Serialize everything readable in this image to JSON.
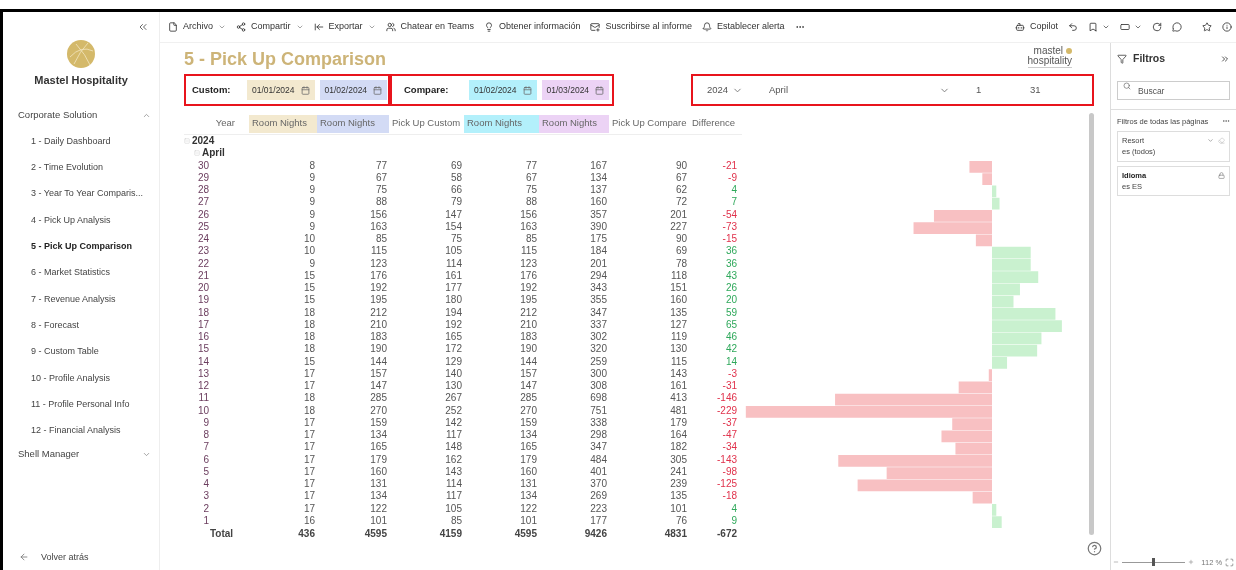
{
  "toolbar": {
    "items": [
      {
        "label": "Archivo",
        "dropdown": true
      },
      {
        "label": "Compartir",
        "dropdown": true
      },
      {
        "label": "Exportar",
        "dropdown": true
      },
      {
        "label": "Chatear en Teams",
        "dropdown": false
      },
      {
        "label": "Obtener información",
        "dropdown": false
      },
      {
        "label": "Suscribirse al informe",
        "dropdown": false
      },
      {
        "label": "Establecer alerta",
        "dropdown": false
      }
    ],
    "copilot": "Copilot"
  },
  "sidebar": {
    "brand": "Mastel Hospitality",
    "sections": [
      {
        "label": "Corporate Solution",
        "expanded": true,
        "children": [
          {
            "label": "1 - Daily Dashboard",
            "selected": false
          },
          {
            "label": "2 - Time Evolution",
            "selected": false
          },
          {
            "label": "3 - Year To Year Comparis...",
            "selected": false
          },
          {
            "label": "4 - Pick Up Analysis",
            "selected": false
          },
          {
            "label": "5 - Pick Up Comparison",
            "selected": true
          },
          {
            "label": "6 - Market Statistics",
            "selected": false
          },
          {
            "label": "7 - Revenue Analysis",
            "selected": false
          },
          {
            "label": "8 - Forecast",
            "selected": false
          },
          {
            "label": "9 - Custom Table",
            "selected": false
          },
          {
            "label": "10 - Profile Analysis",
            "selected": false
          },
          {
            "label": "11 - Profile Personal Info",
            "selected": false
          },
          {
            "label": "12 - Financial Analysis",
            "selected": false
          }
        ]
      },
      {
        "label": "Shell Manager",
        "expanded": false
      }
    ],
    "back": "Volver atrás"
  },
  "report": {
    "title": "5 - Pick Up Comparison",
    "logo": {
      "line1": "mastel",
      "line2": "hospitality"
    },
    "custom": {
      "label": "Custom:",
      "from": {
        "value": "01/01/2024",
        "color": "#f3e9cf"
      },
      "to": {
        "value": "01/02/2024",
        "color": "#d3dbf5"
      }
    },
    "compare": {
      "label": "Compare:",
      "from": {
        "value": "01/02/2024",
        "color": "#b3f0fb"
      },
      "to": {
        "value": "01/03/2024",
        "color": "#ecd3f5"
      }
    },
    "slicer": {
      "year": "2024",
      "month": "April",
      "day_from": "1",
      "day_to": "31"
    },
    "table": {
      "columns": [
        {
          "label": "Year"
        },
        {
          "label": "Room Nights",
          "color": "#f3e9cf"
        },
        {
          "label": "Room Nights",
          "color": "#d3dbf5"
        },
        {
          "label": "Pick Up Custom"
        },
        {
          "label": "Room Nights",
          "color": "#b3f0fb"
        },
        {
          "label": "Room Nights",
          "color": "#ecd3f5"
        },
        {
          "label": "Pick Up Compare"
        },
        {
          "label": "Difference"
        }
      ],
      "groups": [
        "2024",
        "April"
      ],
      "rows": [
        [
          "30",
          "8",
          "77",
          "69",
          "77",
          "167",
          "90",
          "-21"
        ],
        [
          "29",
          "9",
          "67",
          "58",
          "67",
          "134",
          "67",
          "-9"
        ],
        [
          "28",
          "9",
          "75",
          "66",
          "75",
          "137",
          "62",
          "4"
        ],
        [
          "27",
          "9",
          "88",
          "79",
          "88",
          "160",
          "72",
          "7"
        ],
        [
          "26",
          "9",
          "156",
          "147",
          "156",
          "357",
          "201",
          "-54"
        ],
        [
          "25",
          "9",
          "163",
          "154",
          "163",
          "390",
          "227",
          "-73"
        ],
        [
          "24",
          "10",
          "85",
          "75",
          "85",
          "175",
          "90",
          "-15"
        ],
        [
          "23",
          "10",
          "115",
          "105",
          "115",
          "184",
          "69",
          "36"
        ],
        [
          "22",
          "9",
          "123",
          "114",
          "123",
          "201",
          "78",
          "36"
        ],
        [
          "21",
          "15",
          "176",
          "161",
          "176",
          "294",
          "118",
          "43"
        ],
        [
          "20",
          "15",
          "192",
          "177",
          "192",
          "343",
          "151",
          "26"
        ],
        [
          "19",
          "15",
          "195",
          "180",
          "195",
          "355",
          "160",
          "20"
        ],
        [
          "18",
          "18",
          "212",
          "194",
          "212",
          "347",
          "135",
          "59"
        ],
        [
          "17",
          "18",
          "210",
          "192",
          "210",
          "337",
          "127",
          "65"
        ],
        [
          "16",
          "18",
          "183",
          "165",
          "183",
          "302",
          "119",
          "46"
        ],
        [
          "15",
          "18",
          "190",
          "172",
          "190",
          "320",
          "130",
          "42"
        ],
        [
          "14",
          "15",
          "144",
          "129",
          "144",
          "259",
          "115",
          "14"
        ],
        [
          "13",
          "17",
          "157",
          "140",
          "157",
          "300",
          "143",
          "-3"
        ],
        [
          "12",
          "17",
          "147",
          "130",
          "147",
          "308",
          "161",
          "-31"
        ],
        [
          "11",
          "18",
          "285",
          "267",
          "285",
          "698",
          "413",
          "-146"
        ],
        [
          "10",
          "18",
          "270",
          "252",
          "270",
          "751",
          "481",
          "-229"
        ],
        [
          "9",
          "17",
          "159",
          "142",
          "159",
          "338",
          "179",
          "-37"
        ],
        [
          "8",
          "17",
          "134",
          "117",
          "134",
          "298",
          "164",
          "-47"
        ],
        [
          "7",
          "17",
          "165",
          "148",
          "165",
          "347",
          "182",
          "-34"
        ],
        [
          "6",
          "17",
          "179",
          "162",
          "179",
          "484",
          "305",
          "-143"
        ],
        [
          "5",
          "17",
          "160",
          "143",
          "160",
          "401",
          "241",
          "-98"
        ],
        [
          "4",
          "17",
          "131",
          "114",
          "131",
          "370",
          "239",
          "-125"
        ],
        [
          "3",
          "17",
          "134",
          "117",
          "134",
          "269",
          "135",
          "-18"
        ],
        [
          "2",
          "17",
          "122",
          "105",
          "122",
          "223",
          "101",
          "4"
        ],
        [
          "1",
          "16",
          "101",
          "85",
          "101",
          "177",
          "76",
          "9"
        ]
      ],
      "total": [
        "Total",
        "436",
        "4595",
        "4159",
        "4595",
        "9426",
        "4831",
        "-672"
      ]
    }
  },
  "filters": {
    "title": "Filtros",
    "search_placeholder": "Buscar",
    "section": "Filtros de todas las páginas",
    "cards": [
      {
        "name": "Resort",
        "value": "es (todos)",
        "locked": false
      },
      {
        "name": "Idioma",
        "value": "es ES",
        "locked": true
      }
    ]
  },
  "zoom": {
    "level": 0.5,
    "reading": "112 %"
  }
}
